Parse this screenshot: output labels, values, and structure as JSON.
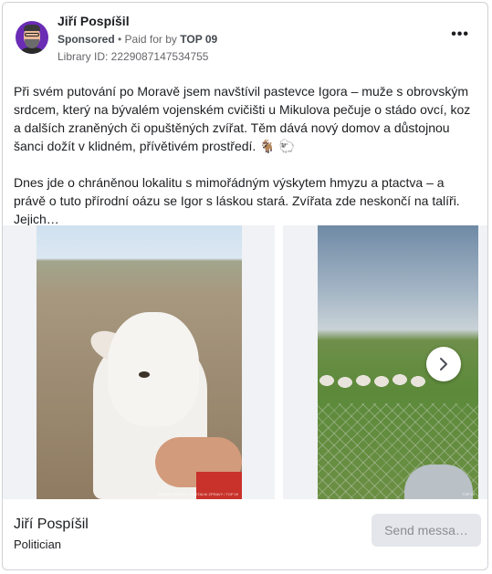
{
  "post": {
    "author": "Jiří Pospíšil",
    "sponsored": "Sponsored",
    "paid_for_by_prefix": "• Paid for by",
    "paid_for_by": "TOP 09",
    "library_id": "Library ID: 2229087147534755",
    "more_label": "•••",
    "paragraph1": "Při svém putování po Moravě jsem navštívil pastevce Igora – muže s obrovským srdcem, který na bývalém vojenském cvičišti u Mikulova pečuje o stádo ovcí, koz a dalších zraněných či opuštěných zvířat. Těm dává nový domov a důstojnou šanci dožít v klidném, přívětivém prostředí. 🐐 🐑",
    "paragraph2": "Dnes jde o chráněnou lokalitu s mimořádným výskytem hmyzu a ptactva – a právě o tuto přírodní oázu se Igor s láskou stará. Zvířata zde neskončí na talíři. Jejich…"
  },
  "carousel": {
    "next_icon": "chevron-right-icon",
    "watermark1": "MARTIN SKRUNY / DIGITALNI ZPRAVY / TOP 09",
    "watermark2": "TOP 09"
  },
  "footer": {
    "name": "Jiří Pospíšil",
    "role": "Politician",
    "send_label": "Send messa…"
  },
  "colors": {
    "accent_purple": "#6a2bb5",
    "button_bg": "#e4e6eb",
    "muted_text": "#65676b"
  }
}
